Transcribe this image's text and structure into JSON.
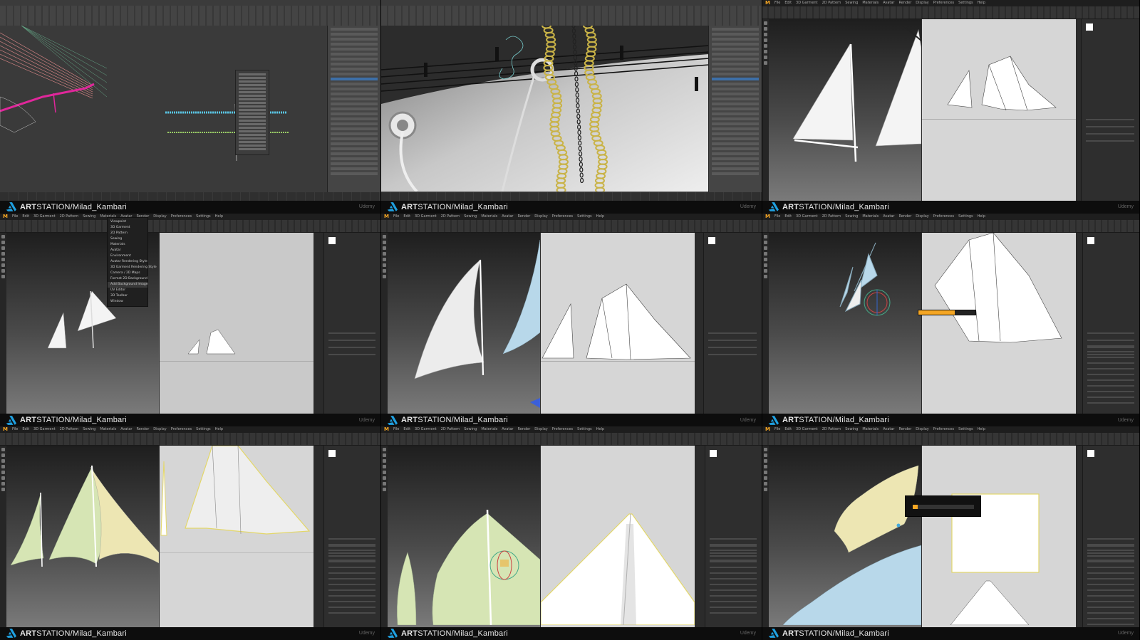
{
  "footer": {
    "brand_bold": "ART",
    "brand_rest": "STATION/Milad_Kambari",
    "platform": "Udemy"
  },
  "app_marvelous": {
    "logo": "M",
    "menus": [
      "File",
      "Edit",
      "3D Garment",
      "2D Pattern",
      "Sewing",
      "Materials",
      "Avatar",
      "Render",
      "Display",
      "Preferences",
      "Settings",
      "Help"
    ]
  },
  "app_max": {
    "logo_icon": "max-logo-icon"
  },
  "display_dropdown": {
    "items": [
      "Viewpoint",
      "3D Garment",
      "2D Pattern",
      "Sewing",
      "Materials",
      "Avatar",
      "Environment",
      "Avatar Rendering Style",
      "3D Garment Rendering Style",
      "Camera / 2D Maps",
      "Format 2D Background",
      "Add Background Image",
      "UV Editor",
      "3D Toolbar",
      "Window"
    ],
    "highlighted_index": 11
  },
  "colors": {
    "accent_orange": "#f5a623",
    "artstation_blue": "#1fa0e0",
    "sail_white": "#f4f4f4",
    "sail_blue": "#b8d8ea",
    "sail_green": "#d6e5b4",
    "sail_yellow": "#ede6b3",
    "selection_yellow": "#e3d76a",
    "rope_gold": "#c9b347",
    "max_magenta": "#e0279b",
    "max_cyan": "#5ac8e8"
  }
}
